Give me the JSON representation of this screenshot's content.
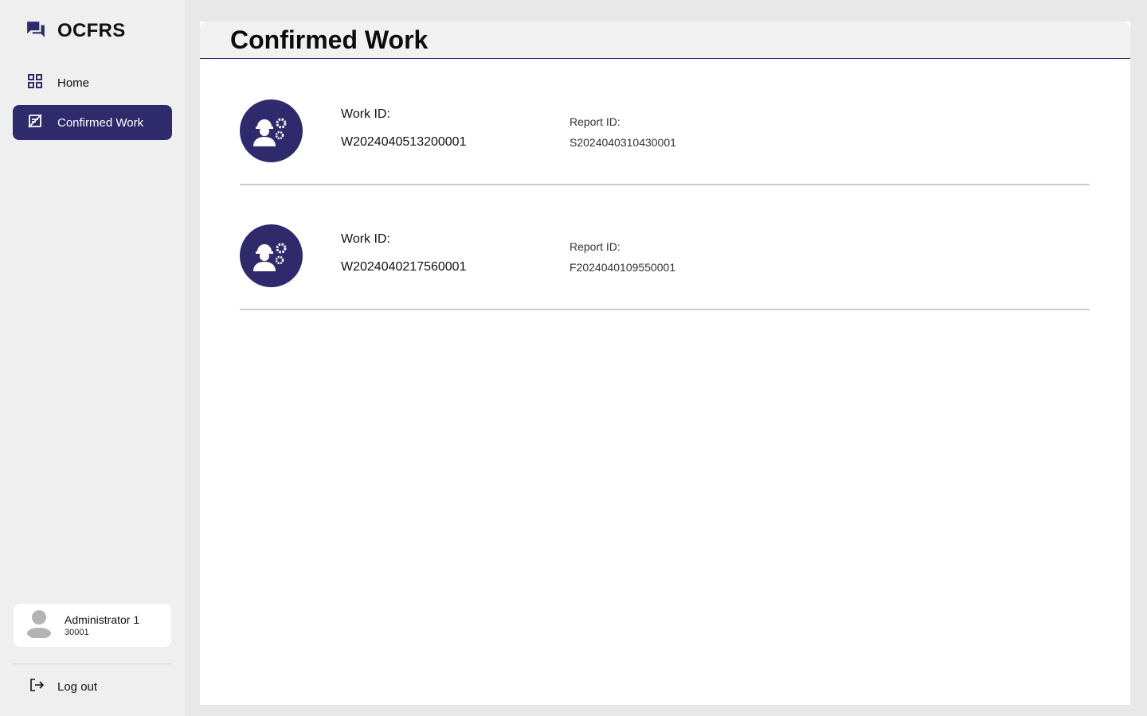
{
  "app": {
    "title": "OCFRS"
  },
  "nav": {
    "home_label": "Home",
    "confirmed_label": "Confirmed Work"
  },
  "user": {
    "name": "Administrator 1",
    "id": "30001"
  },
  "logout_label": "Log out",
  "page": {
    "title": "Confirmed Work"
  },
  "work_items": [
    {
      "work_label": "Work ID:",
      "work_id": "W2024040513200001",
      "report_label": "Report ID:",
      "report_id": "S2024040310430001"
    },
    {
      "work_label": "Work ID:",
      "work_id": "W2024040217560001",
      "report_label": "Report ID:",
      "report_id": "F2024040109550001"
    }
  ],
  "colors": {
    "accent": "#2e2a6b",
    "sidebar_bg": "#efefef",
    "page_bg": "#e8e8e8"
  },
  "icons": [
    "chat-icon",
    "grid-icon",
    "confirmed-work-icon",
    "user-avatar-icon",
    "logout-icon",
    "worker-gear-icon"
  ]
}
